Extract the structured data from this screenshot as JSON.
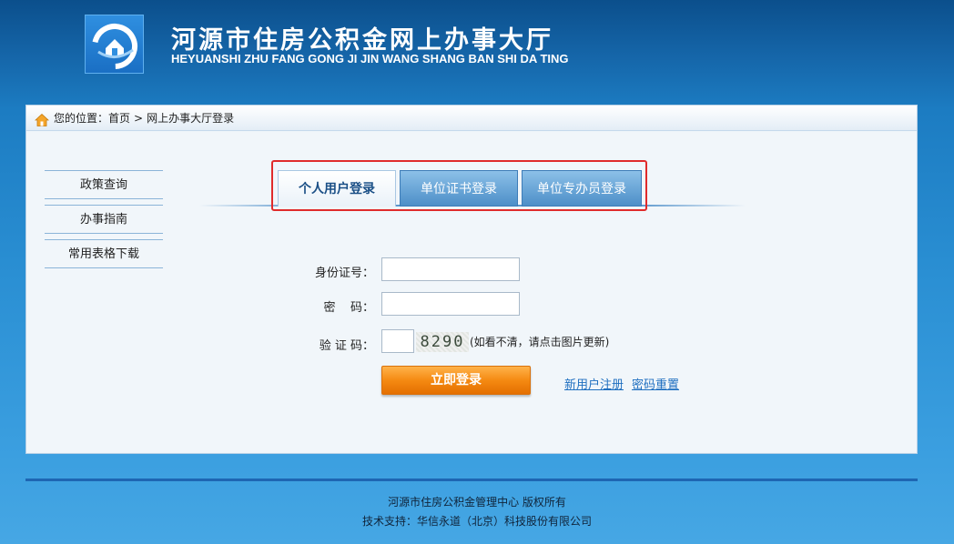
{
  "header": {
    "title_cn": "河源市住房公积金网上办事大厅",
    "title_en": "HEYUANSHI ZHU FANG GONG JI JIN WANG SHANG BAN SHI DA TING",
    "logo_icon": "housing-fund-logo-icon"
  },
  "breadcrumb": {
    "prefix": "您的位置：",
    "home": "首页",
    "separator": ">",
    "current": "网上办事大厅登录"
  },
  "sidebar": {
    "items": [
      {
        "label": "政策查询"
      },
      {
        "label": "办事指南"
      },
      {
        "label": "常用表格下载"
      }
    ]
  },
  "tabs": [
    {
      "label": "个人用户登录",
      "active": true
    },
    {
      "label": "单位证书登录",
      "active": false
    },
    {
      "label": "单位专办员登录",
      "active": false
    }
  ],
  "form": {
    "id_label": "身份证号：",
    "id_value": "",
    "password_label": "密    码：",
    "password_value": "",
    "captcha_label": "验 证 码：",
    "captcha_value": "",
    "captcha_code": "8290",
    "captcha_hint": "(如看不清，请点击图片更新)",
    "submit_label": "立即登录",
    "register_link": "新用户注册",
    "reset_link": "密码重置"
  },
  "footer": {
    "line1": "河源市住房公积金管理中心 版权所有",
    "line2": "技术支持：华信永道（北京）科技股份有限公司"
  },
  "colors": {
    "header_bg": "#1565a8",
    "active_tab_text": "#1a4f86",
    "login_button": "#f58a12",
    "link": "#1f6fc0",
    "highlight_frame": "#e02b2b"
  }
}
